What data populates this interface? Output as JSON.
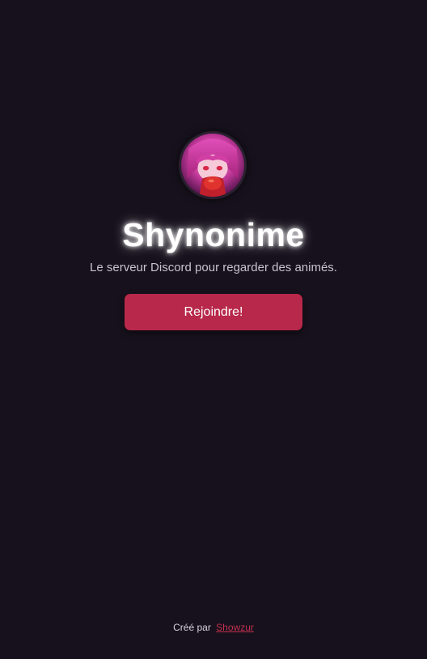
{
  "server": {
    "name": "Shynonime",
    "description": "Le serveur Discord pour regarder des animés.",
    "avatar_icon": "anime-character-avatar"
  },
  "actions": {
    "join_label": "Rejoindre!"
  },
  "footer": {
    "created_by_label": "Créé par",
    "author_name": "Showzur"
  },
  "colors": {
    "background": "#16111c",
    "accent": "#b8284a",
    "link": "#c2304f"
  }
}
